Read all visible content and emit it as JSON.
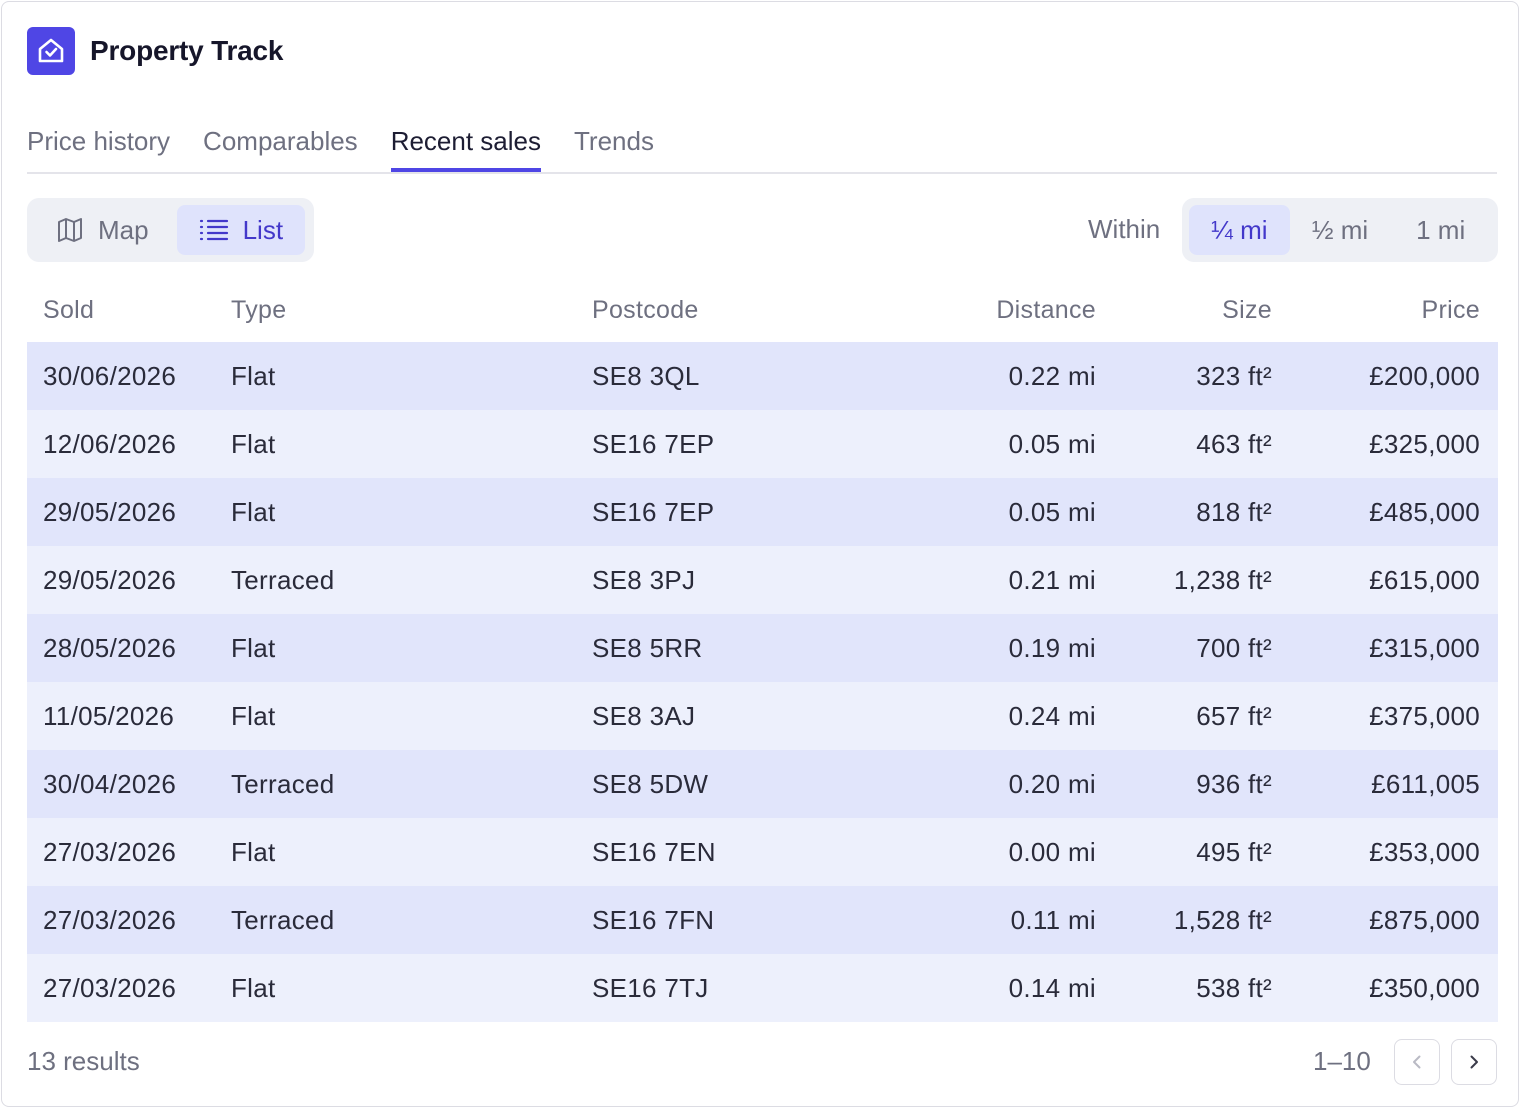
{
  "app": {
    "title": "Property Track",
    "logo_icon": "house-check-icon",
    "accent": "#4f46e5"
  },
  "tabs": [
    {
      "label": "Price history",
      "active": false
    },
    {
      "label": "Comparables",
      "active": false
    },
    {
      "label": "Recent sales",
      "active": true
    },
    {
      "label": "Trends",
      "active": false
    }
  ],
  "view_toggle": {
    "map": {
      "label": "Map",
      "icon": "map-icon",
      "active": false
    },
    "list": {
      "label": "List",
      "icon": "list-icon",
      "active": true
    }
  },
  "radius": {
    "label": "Within",
    "options": [
      {
        "label": "¼ mi",
        "active": true
      },
      {
        "label": "½ mi",
        "active": false
      },
      {
        "label": "1 mi",
        "active": false
      }
    ]
  },
  "table": {
    "columns": [
      "Sold",
      "Type",
      "Postcode",
      "Distance",
      "Size",
      "Price"
    ],
    "rows": [
      [
        "30/06/2026",
        "Flat",
        "SE8 3QL",
        "0.22 mi",
        "323 ft²",
        "£200,000"
      ],
      [
        "12/06/2026",
        "Flat",
        "SE16 7EP",
        "0.05 mi",
        "463 ft²",
        "£325,000"
      ],
      [
        "29/05/2026",
        "Flat",
        "SE16 7EP",
        "0.05 mi",
        "818 ft²",
        "£485,000"
      ],
      [
        "29/05/2026",
        "Terraced",
        "SE8 3PJ",
        "0.21 mi",
        "1,238 ft²",
        "£615,000"
      ],
      [
        "28/05/2026",
        "Flat",
        "SE8 5RR",
        "0.19 mi",
        "700 ft²",
        "£315,000"
      ],
      [
        "11/05/2026",
        "Flat",
        "SE8 3AJ",
        "0.24 mi",
        "657 ft²",
        "£375,000"
      ],
      [
        "30/04/2026",
        "Terraced",
        "SE8 5DW",
        "0.20 mi",
        "936 ft²",
        "£611,005"
      ],
      [
        "27/03/2026",
        "Flat",
        "SE16 7EN",
        "0.00 mi",
        "495 ft²",
        "£353,000"
      ],
      [
        "27/03/2026",
        "Terraced",
        "SE16 7FN",
        "0.11 mi",
        "1,528 ft²",
        "£875,000"
      ],
      [
        "27/03/2026",
        "Flat",
        "SE16 7TJ",
        "0.14 mi",
        "538 ft²",
        "£350,000"
      ]
    ]
  },
  "footer": {
    "results": "13 results",
    "range": "1–10",
    "prev_icon": "chevron-left-icon",
    "next_icon": "chevron-right-icon"
  }
}
